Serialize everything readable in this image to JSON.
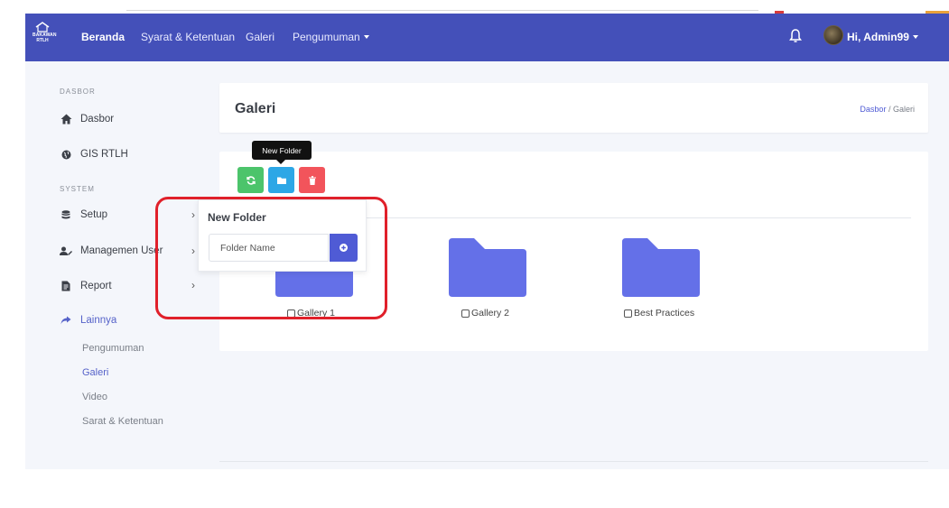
{
  "logo": {
    "line1": "BAKAWAN",
    "line2": "RTLH"
  },
  "navbar": {
    "items": [
      {
        "label": "Beranda"
      },
      {
        "label": "Syarat & Ketentuan"
      },
      {
        "label": "Galeri"
      },
      {
        "label": "Pengumuman"
      }
    ],
    "user_label": "Hi, Admin99"
  },
  "sidebar": {
    "heading_dasbor": "DASBOR",
    "heading_system": "SYSTEM",
    "items": [
      {
        "label": "Dasbor",
        "icon": "home-icon"
      },
      {
        "label": "GIS RTLH",
        "icon": "globe-icon"
      },
      {
        "label": "Setup",
        "icon": "database-icon"
      },
      {
        "label": "Managemen User",
        "icon": "users-icon"
      },
      {
        "label": "Report",
        "icon": "report-icon"
      },
      {
        "label": "Lainnya",
        "icon": "share-icon"
      }
    ],
    "subitems": [
      {
        "label": "Pengumuman"
      },
      {
        "label": "Galeri"
      },
      {
        "label": "Video"
      },
      {
        "label": "Sarat & Ketentuan"
      }
    ]
  },
  "page": {
    "title": "Galeri",
    "breadcrumb_link": "Dasbor",
    "breadcrumb_sep": "/",
    "breadcrumb_current": "Galeri"
  },
  "toolbar": {
    "tooltip": "New Folder"
  },
  "popover": {
    "title": "New Folder",
    "input_placeholder": "Folder Name"
  },
  "folders": [
    {
      "name": "Gallery 1"
    },
    {
      "name": "Gallery 2"
    },
    {
      "name": "Best Practices"
    }
  ],
  "colors": {
    "navbar": "#4450b9",
    "accent": "#4f5bd5",
    "folder": "#6470e8",
    "refresh_button": "#4cc46b",
    "folder_button": "#2da7e6",
    "delete_button": "#f2545b",
    "highlight": "#e0202a"
  }
}
